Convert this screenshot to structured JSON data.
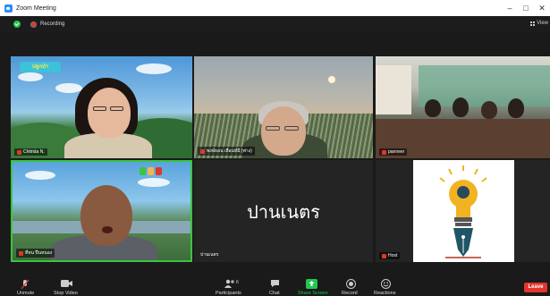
{
  "window": {
    "title": "Zoom Meeting",
    "controls": [
      "–",
      "□",
      "✕"
    ]
  },
  "meeting": {
    "recording_label": "Recording",
    "view_label": "View"
  },
  "tiles": [
    {
      "name": "Chitrida N.",
      "muted": true,
      "badge": "ปลูกป่า"
    },
    {
      "name": "พงษ์ธอน เยือนท์มี (พ่าง)",
      "muted": true
    },
    {
      "name": "panneer",
      "muted": true
    },
    {
      "name": "ที่ทน ปืนหนอง",
      "muted": true,
      "active_speaker": true
    },
    {
      "name": "ปานเนตร",
      "display_name": "ปานเนตร",
      "muted": false
    },
    {
      "name": "Host",
      "muted": true
    }
  ],
  "toolbar": {
    "unmute": "Unmute",
    "stop_video": "Stop Video",
    "participants": "Participants",
    "participants_count": "6",
    "chat": "Chat",
    "share_screen": "Share Screen",
    "record": "Record",
    "reactions": "Reactions",
    "leave": "Leave"
  },
  "colors": {
    "active_speaker": "#39c53f",
    "leave": "#e0362c",
    "share": "#23c552"
  }
}
